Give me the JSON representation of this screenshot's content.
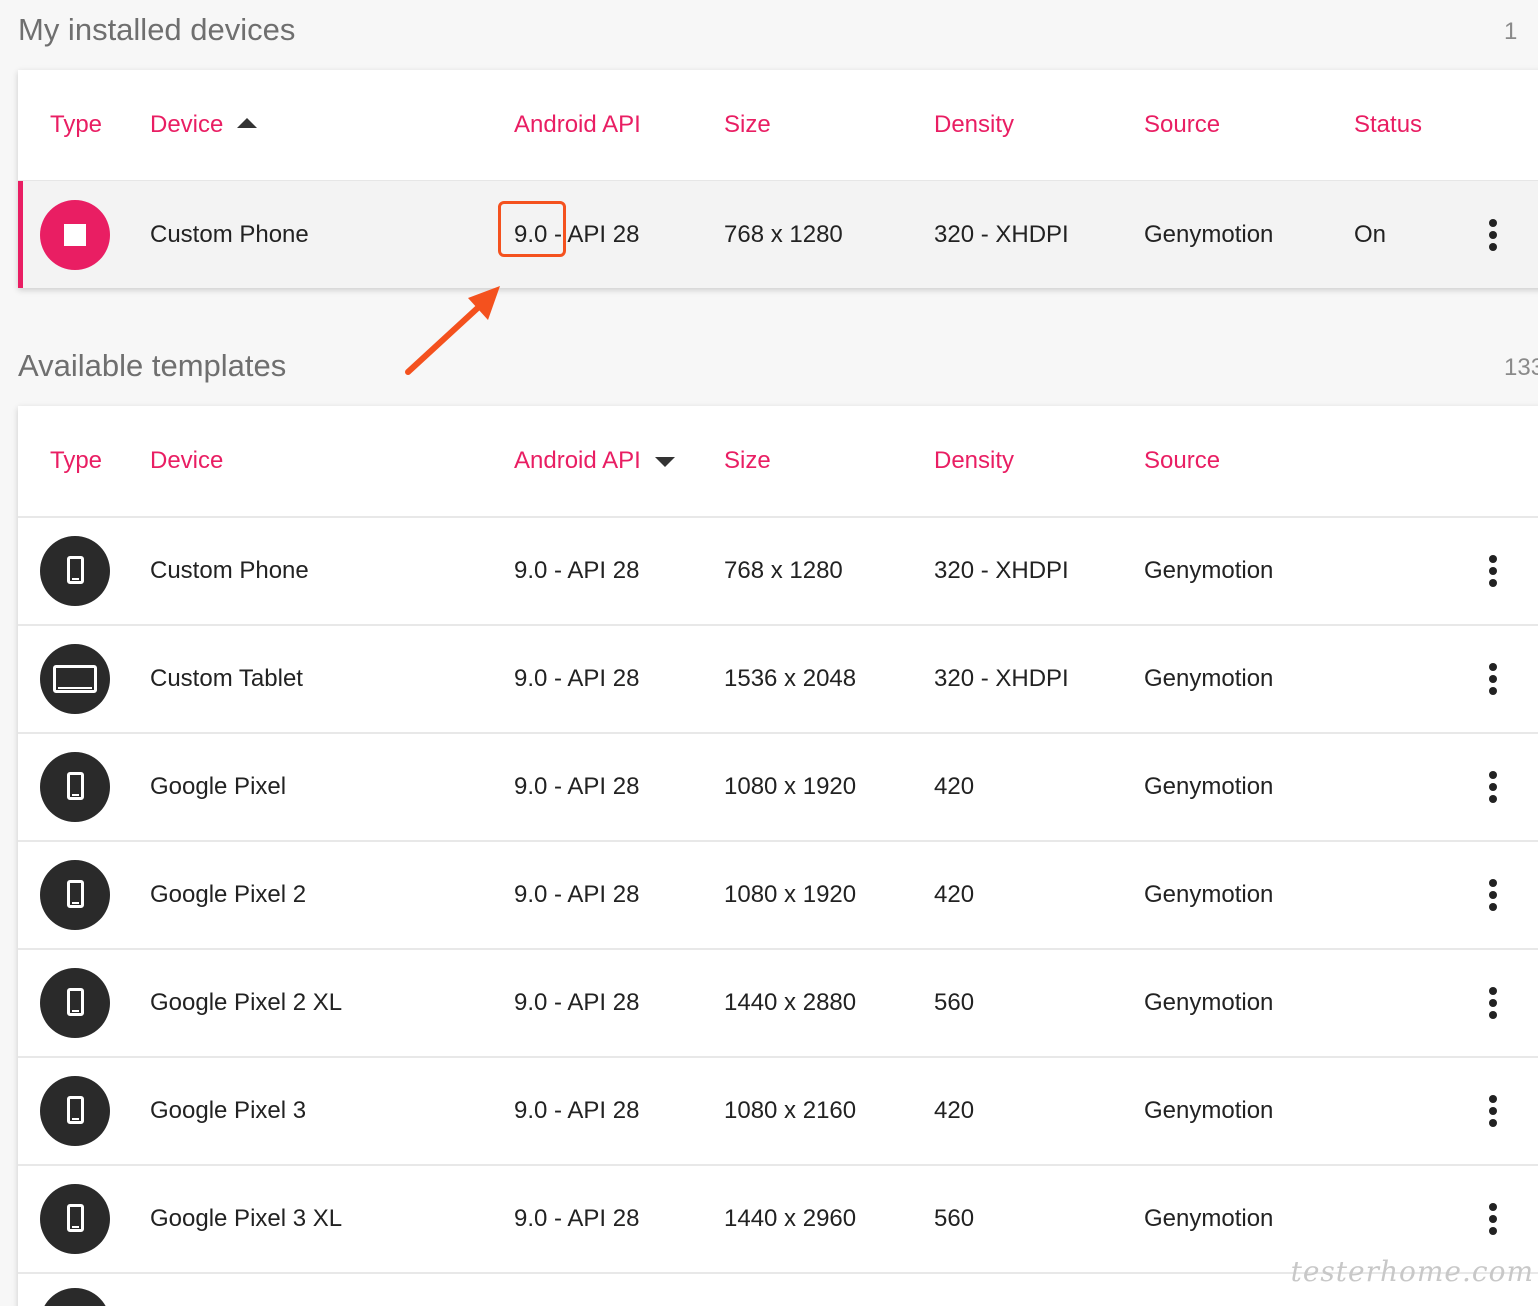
{
  "installed": {
    "title": "My installed devices",
    "count": "1",
    "headers": {
      "type": "Type",
      "device": "Device",
      "api": "Android API",
      "size": "Size",
      "density": "Density",
      "source": "Source",
      "status": "Status"
    },
    "rows": [
      {
        "device": "Custom Phone",
        "api": "9.0 - API 28",
        "size": "768 x 1280",
        "density": "320 - XHDPI",
        "source": "Genymotion",
        "status": "On"
      }
    ]
  },
  "templates": {
    "title": "Available templates",
    "count": "133",
    "headers": {
      "type": "Type",
      "device": "Device",
      "api": "Android API",
      "size": "Size",
      "density": "Density",
      "source": "Source"
    },
    "rows": [
      {
        "device": "Custom Phone",
        "api": "9.0 - API 28",
        "size": "768 x 1280",
        "density": "320 - XHDPI",
        "source": "Genymotion"
      },
      {
        "device": "Custom Tablet",
        "api": "9.0 - API 28",
        "size": "1536 x 2048",
        "density": "320 - XHDPI",
        "source": "Genymotion"
      },
      {
        "device": "Google Pixel",
        "api": "9.0 - API 28",
        "size": "1080 x 1920",
        "density": "420",
        "source": "Genymotion"
      },
      {
        "device": "Google Pixel 2",
        "api": "9.0 - API 28",
        "size": "1080 x 1920",
        "density": "420",
        "source": "Genymotion"
      },
      {
        "device": "Google Pixel 2 XL",
        "api": "9.0 - API 28",
        "size": "1440 x 2880",
        "density": "560",
        "source": "Genymotion"
      },
      {
        "device": "Google Pixel 3",
        "api": "9.0 - API 28",
        "size": "1080 x 2160",
        "density": "420",
        "source": "Genymotion"
      },
      {
        "device": "Google Pixel 3 XL",
        "api": "9.0 - API 28",
        "size": "1440 x 2960",
        "density": "560",
        "source": "Genymotion"
      }
    ]
  },
  "watermark": "testerhome.com",
  "colors": {
    "accent": "#e91e63",
    "annotation": "#f4511e",
    "icon_bg": "#2a2a2a"
  },
  "icons": {
    "running": "stop-icon",
    "phone": "phone-icon",
    "tablet": "tablet-icon",
    "more": "more-vert-icon"
  }
}
